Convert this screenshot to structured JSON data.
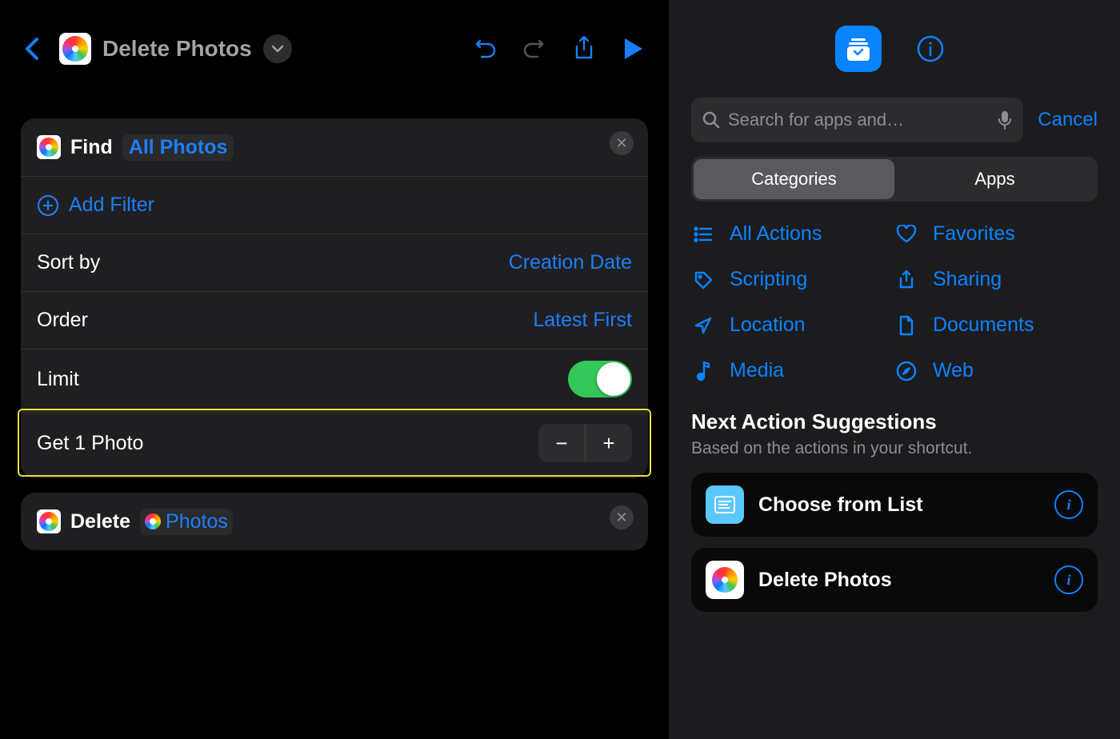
{
  "header": {
    "title": "Delete Photos"
  },
  "find_action": {
    "verb": "Find",
    "param": "All Photos",
    "add_filter": "Add Filter",
    "sort_by_label": "Sort by",
    "sort_by_value": "Creation Date",
    "order_label": "Order",
    "order_value": "Latest First",
    "limit_label": "Limit",
    "limit_on": true,
    "get_label": "Get 1 Photo"
  },
  "delete_action": {
    "verb": "Delete",
    "param": "Photos"
  },
  "search": {
    "placeholder": "Search for apps and…",
    "cancel": "Cancel"
  },
  "segment": {
    "categories": "Categories",
    "apps": "Apps"
  },
  "categories": {
    "all_actions": "All Actions",
    "favorites": "Favorites",
    "scripting": "Scripting",
    "sharing": "Sharing",
    "location": "Location",
    "documents": "Documents",
    "media": "Media",
    "web": "Web"
  },
  "suggestions": {
    "title": "Next Action Suggestions",
    "subtitle": "Based on the actions in your shortcut.",
    "items": [
      {
        "label": "Choose from List"
      },
      {
        "label": "Delete Photos"
      }
    ]
  }
}
